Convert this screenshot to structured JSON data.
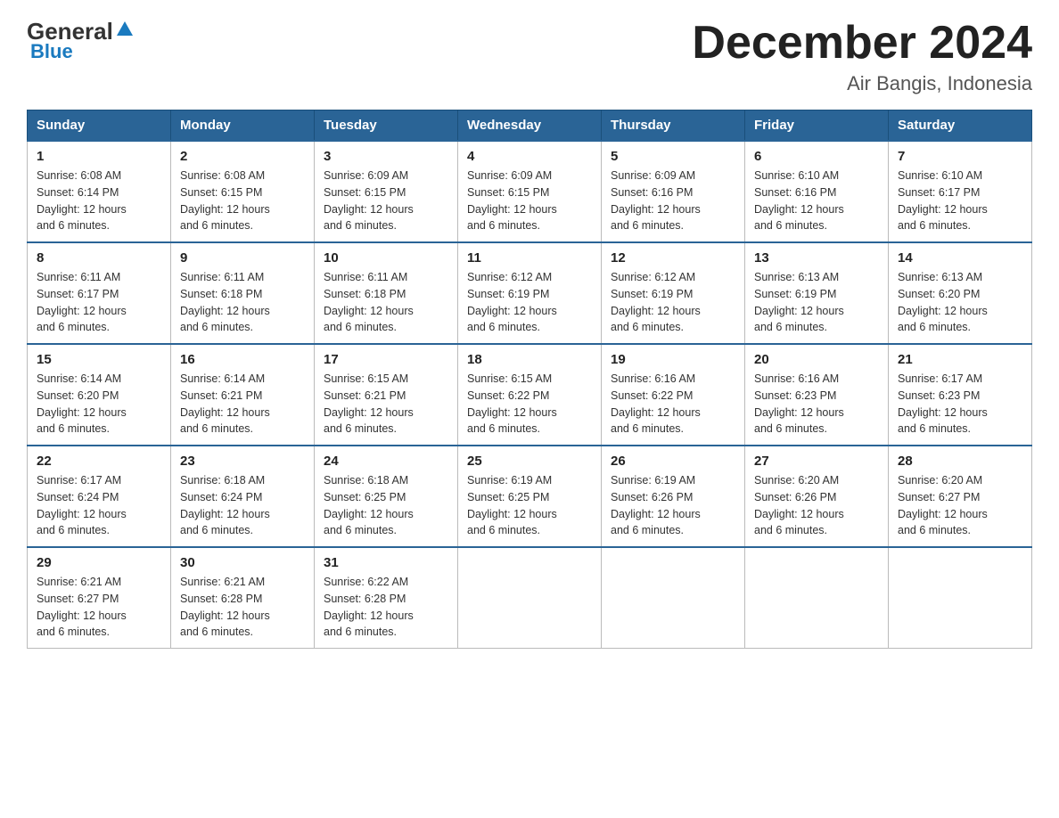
{
  "header": {
    "logo_general": "General",
    "logo_blue": "Blue",
    "title": "December 2024",
    "subtitle": "Air Bangis, Indonesia"
  },
  "days_of_week": [
    "Sunday",
    "Monday",
    "Tuesday",
    "Wednesday",
    "Thursday",
    "Friday",
    "Saturday"
  ],
  "weeks": [
    [
      {
        "day": "1",
        "sunrise": "6:08 AM",
        "sunset": "6:14 PM",
        "daylight": "12 hours and 6 minutes."
      },
      {
        "day": "2",
        "sunrise": "6:08 AM",
        "sunset": "6:15 PM",
        "daylight": "12 hours and 6 minutes."
      },
      {
        "day": "3",
        "sunrise": "6:09 AM",
        "sunset": "6:15 PM",
        "daylight": "12 hours and 6 minutes."
      },
      {
        "day": "4",
        "sunrise": "6:09 AM",
        "sunset": "6:15 PM",
        "daylight": "12 hours and 6 minutes."
      },
      {
        "day": "5",
        "sunrise": "6:09 AM",
        "sunset": "6:16 PM",
        "daylight": "12 hours and 6 minutes."
      },
      {
        "day": "6",
        "sunrise": "6:10 AM",
        "sunset": "6:16 PM",
        "daylight": "12 hours and 6 minutes."
      },
      {
        "day": "7",
        "sunrise": "6:10 AM",
        "sunset": "6:17 PM",
        "daylight": "12 hours and 6 minutes."
      }
    ],
    [
      {
        "day": "8",
        "sunrise": "6:11 AM",
        "sunset": "6:17 PM",
        "daylight": "12 hours and 6 minutes."
      },
      {
        "day": "9",
        "sunrise": "6:11 AM",
        "sunset": "6:18 PM",
        "daylight": "12 hours and 6 minutes."
      },
      {
        "day": "10",
        "sunrise": "6:11 AM",
        "sunset": "6:18 PM",
        "daylight": "12 hours and 6 minutes."
      },
      {
        "day": "11",
        "sunrise": "6:12 AM",
        "sunset": "6:19 PM",
        "daylight": "12 hours and 6 minutes."
      },
      {
        "day": "12",
        "sunrise": "6:12 AM",
        "sunset": "6:19 PM",
        "daylight": "12 hours and 6 minutes."
      },
      {
        "day": "13",
        "sunrise": "6:13 AM",
        "sunset": "6:19 PM",
        "daylight": "12 hours and 6 minutes."
      },
      {
        "day": "14",
        "sunrise": "6:13 AM",
        "sunset": "6:20 PM",
        "daylight": "12 hours and 6 minutes."
      }
    ],
    [
      {
        "day": "15",
        "sunrise": "6:14 AM",
        "sunset": "6:20 PM",
        "daylight": "12 hours and 6 minutes."
      },
      {
        "day": "16",
        "sunrise": "6:14 AM",
        "sunset": "6:21 PM",
        "daylight": "12 hours and 6 minutes."
      },
      {
        "day": "17",
        "sunrise": "6:15 AM",
        "sunset": "6:21 PM",
        "daylight": "12 hours and 6 minutes."
      },
      {
        "day": "18",
        "sunrise": "6:15 AM",
        "sunset": "6:22 PM",
        "daylight": "12 hours and 6 minutes."
      },
      {
        "day": "19",
        "sunrise": "6:16 AM",
        "sunset": "6:22 PM",
        "daylight": "12 hours and 6 minutes."
      },
      {
        "day": "20",
        "sunrise": "6:16 AM",
        "sunset": "6:23 PM",
        "daylight": "12 hours and 6 minutes."
      },
      {
        "day": "21",
        "sunrise": "6:17 AM",
        "sunset": "6:23 PM",
        "daylight": "12 hours and 6 minutes."
      }
    ],
    [
      {
        "day": "22",
        "sunrise": "6:17 AM",
        "sunset": "6:24 PM",
        "daylight": "12 hours and 6 minutes."
      },
      {
        "day": "23",
        "sunrise": "6:18 AM",
        "sunset": "6:24 PM",
        "daylight": "12 hours and 6 minutes."
      },
      {
        "day": "24",
        "sunrise": "6:18 AM",
        "sunset": "6:25 PM",
        "daylight": "12 hours and 6 minutes."
      },
      {
        "day": "25",
        "sunrise": "6:19 AM",
        "sunset": "6:25 PM",
        "daylight": "12 hours and 6 minutes."
      },
      {
        "day": "26",
        "sunrise": "6:19 AM",
        "sunset": "6:26 PM",
        "daylight": "12 hours and 6 minutes."
      },
      {
        "day": "27",
        "sunrise": "6:20 AM",
        "sunset": "6:26 PM",
        "daylight": "12 hours and 6 minutes."
      },
      {
        "day": "28",
        "sunrise": "6:20 AM",
        "sunset": "6:27 PM",
        "daylight": "12 hours and 6 minutes."
      }
    ],
    [
      {
        "day": "29",
        "sunrise": "6:21 AM",
        "sunset": "6:27 PM",
        "daylight": "12 hours and 6 minutes."
      },
      {
        "day": "30",
        "sunrise": "6:21 AM",
        "sunset": "6:28 PM",
        "daylight": "12 hours and 6 minutes."
      },
      {
        "day": "31",
        "sunrise": "6:22 AM",
        "sunset": "6:28 PM",
        "daylight": "12 hours and 6 minutes."
      },
      null,
      null,
      null,
      null
    ]
  ],
  "labels": {
    "sunrise": "Sunrise:",
    "sunset": "Sunset:",
    "daylight": "Daylight:"
  }
}
